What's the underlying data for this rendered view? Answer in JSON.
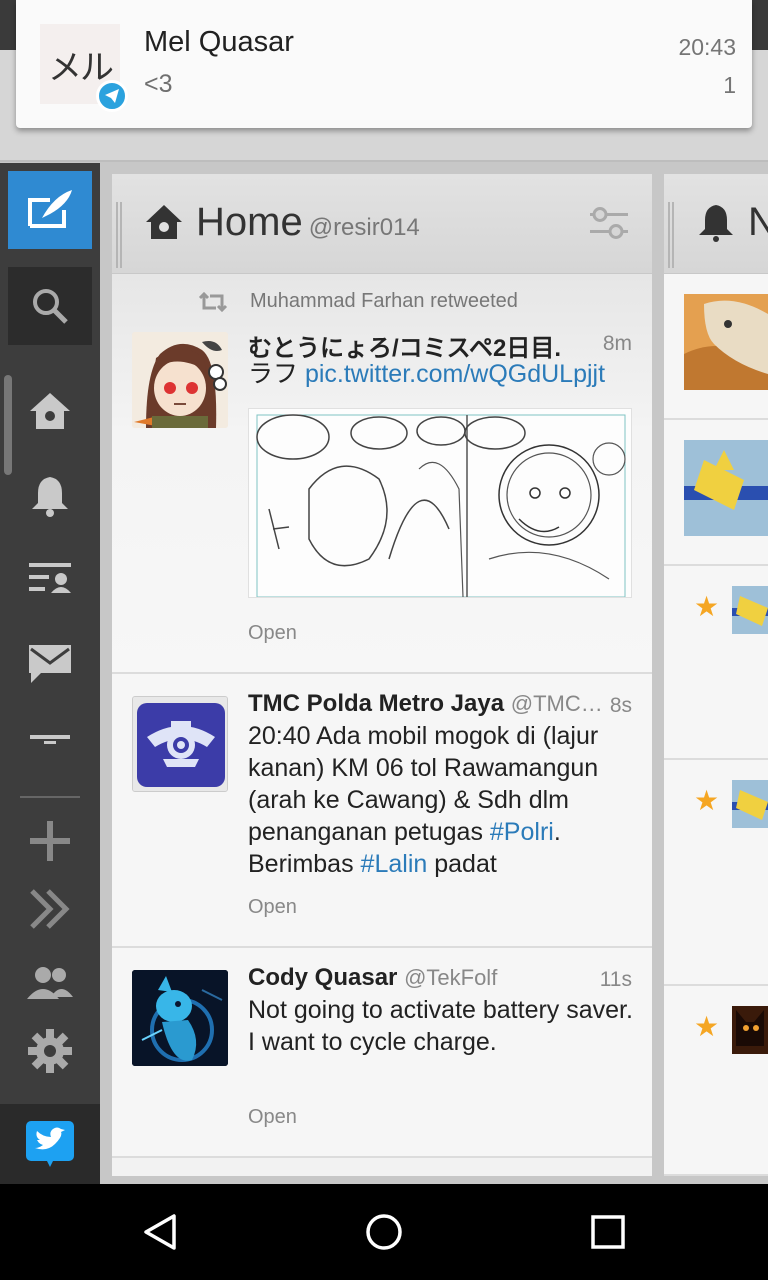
{
  "notification": {
    "avatar_text": "メル",
    "title": "Mel Quasar",
    "text": "<3",
    "time": "20:43",
    "count": "1"
  },
  "sidebar": {
    "icons": [
      "compose-icon",
      "search-icon",
      "home-icon",
      "bell-icon",
      "lists-icon",
      "mail-icon",
      "minus-icon",
      "plus-icon",
      "chevrons-icon",
      "people-icon",
      "gear-icon",
      "twitter-icon"
    ]
  },
  "columns": [
    {
      "number": "1",
      "title": "Home",
      "subtitle": "@resir014",
      "tweets": [
        {
          "retweeted_by": "Muhammad Farhan retweeted",
          "name": "むとうにょろ/コミスペ2日目.",
          "handle": "",
          "time": "8m",
          "text": "ラフ ",
          "link": "pic.twitter.com/wQGdULpjjt",
          "open": "Open"
        },
        {
          "name": "TMC Polda Metro Jaya",
          "handle": "@TMC…",
          "time": "8s",
          "text_parts": [
            "20:40 Ada mobil mogok di (lajur kanan) KM 06 tol Rawamangun (arah ke Cawang) & Sdh dlm penanganan petugas ",
            "#Polri",
            ". Berimbas ",
            "#Lalin",
            " padat"
          ],
          "open": "Open"
        },
        {
          "name": "Cody Quasar",
          "handle": "@TekFolf",
          "time": "11s",
          "text_lines": [
            "Not going to activate battery saver.",
            "I want to cycle charge."
          ],
          "open": "Open"
        }
      ]
    },
    {
      "number": "2",
      "title": "N"
    }
  ],
  "colors": {
    "accent": "#2f8ad2",
    "link": "#2b7bb9",
    "star": "#f5a623"
  }
}
